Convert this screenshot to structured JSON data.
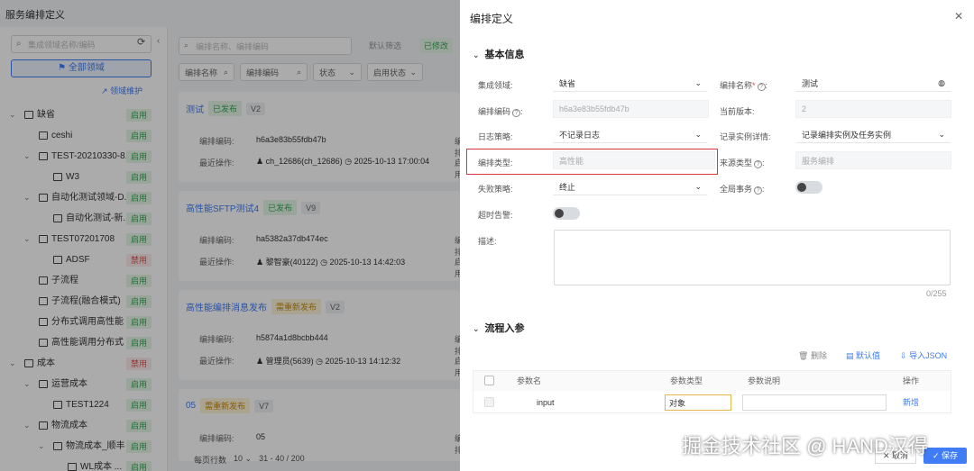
{
  "page_title": "服务编排定义",
  "left": {
    "search_placeholder": "集成领域名称/编码",
    "all_domains": "全部领域",
    "domain_maintenance": "领域维护",
    "tree": [
      {
        "label": "缺省",
        "badge": "启用",
        "status": "on",
        "level": 0,
        "toggle": "⌄",
        "icon": "folder-icon"
      },
      {
        "label": "ceshi",
        "badge": "启用",
        "status": "on",
        "level": 1,
        "toggle": "",
        "icon": "folder-icon"
      },
      {
        "label": "TEST-20210330-8...",
        "badge": "启用",
        "status": "on",
        "level": 1,
        "toggle": "⌄",
        "icon": "folder-icon"
      },
      {
        "label": "W3",
        "badge": "启用",
        "status": "on",
        "level": 2,
        "toggle": "",
        "icon": "node-icon"
      },
      {
        "label": "自动化测试领域-D...",
        "badge": "启用",
        "status": "on",
        "level": 1,
        "toggle": "⌄",
        "icon": "folder-icon"
      },
      {
        "label": "自动化测试-新...",
        "badge": "启用",
        "status": "on",
        "level": 2,
        "toggle": "",
        "icon": "folder-icon"
      },
      {
        "label": "TEST07201708",
        "badge": "启用",
        "status": "on",
        "level": 1,
        "toggle": "⌄",
        "icon": "folder-icon"
      },
      {
        "label": "ADSF",
        "badge": "禁用",
        "status": "off",
        "level": 2,
        "toggle": "",
        "icon": "folder-icon"
      },
      {
        "label": "子流程",
        "badge": "启用",
        "status": "on",
        "level": 1,
        "toggle": "",
        "icon": "subflow-icon"
      },
      {
        "label": "子流程(融合模式)",
        "badge": "启用",
        "status": "on",
        "level": 1,
        "toggle": "",
        "icon": "subflow-icon"
      },
      {
        "label": "分布式调用高性能",
        "badge": "启用",
        "status": "on",
        "level": 1,
        "toggle": "",
        "icon": "distributed-icon"
      },
      {
        "label": "高性能调用分布式",
        "badge": "启用",
        "status": "on",
        "level": 1,
        "toggle": "",
        "icon": "subflow-icon"
      },
      {
        "label": "成本",
        "badge": "禁用",
        "status": "off",
        "level": 0,
        "toggle": "⌄",
        "icon": "folder-icon"
      },
      {
        "label": "运营成本",
        "badge": "启用",
        "status": "on",
        "level": 1,
        "toggle": "⌄",
        "icon": "folder-icon"
      },
      {
        "label": "TEST1224",
        "badge": "启用",
        "status": "on",
        "level": 2,
        "toggle": "",
        "icon": "folder-icon"
      },
      {
        "label": "物流成本",
        "badge": "启用",
        "status": "on",
        "level": 1,
        "toggle": "⌄",
        "icon": "hierarchy-icon"
      },
      {
        "label": "物流成本_顺丰",
        "badge": "启用",
        "status": "on",
        "level": 2,
        "toggle": "⌄",
        "icon": "folder-icon"
      },
      {
        "label": "WL成本 ...",
        "badge": "启用",
        "status": "on",
        "level": 3,
        "toggle": "",
        "icon": "folder-icon"
      }
    ]
  },
  "mid": {
    "search_placeholder": "编排名称、编排编码",
    "default_filter": "默认筛选",
    "filter_tag": "已修改",
    "filters": [
      "编排名称",
      "编排编码",
      "状态",
      "启用状态"
    ],
    "cards": [
      {
        "name": "测试",
        "tag": "已发布",
        "tag_type": "pub",
        "version": "V2",
        "code_label": "编排编码:",
        "code": "h6a3e83b55fdb47b",
        "op_label": "最近操作:",
        "op_user": "ch_12686(ch_12686)",
        "op_time": "2025-10-13 17:00:04",
        "right_1": "编排",
        "right_2": "启用"
      },
      {
        "name": "高性能SFTP测试4",
        "tag": "已发布",
        "tag_type": "pub",
        "version": "V9",
        "code_label": "编排编码:",
        "code": "ha5382a37db474ec",
        "op_label": "最近操作:",
        "op_user": "黎智豪(40122)",
        "op_time": "2025-10-13 14:42:03",
        "right_1": "编排",
        "right_2": "启用"
      },
      {
        "name": "高性能编排消息发布",
        "tag": "需重新发布",
        "tag_type": "need",
        "version": "V2",
        "code_label": "编排编码:",
        "code": "h5874a1d8bcbb444",
        "op_label": "最近操作:",
        "op_user": "管理员(5639)",
        "op_time": "2025-10-13 14:12:32",
        "right_1": "编排",
        "right_2": "启用"
      },
      {
        "name": "05",
        "tag": "需重新发布",
        "tag_type": "need",
        "version": "V7",
        "code_label": "编排编码:",
        "code": "05",
        "op_label": "",
        "op_user": "",
        "op_time": "",
        "right_1": "编排",
        "right_2": ""
      }
    ],
    "pager_label": "每页行数",
    "pager_size": "10",
    "pager_range": "31 - 40 / 200"
  },
  "drawer": {
    "title": "编排定义",
    "basic_info": "基本信息",
    "fields": {
      "domain_label": "集成领域:",
      "domain_value": "缺省",
      "name_label": "编排名称",
      "name_value": "测试",
      "code_label": "编排编码",
      "code_value": "h6a3e83b55fdb47b",
      "version_label": "当前版本:",
      "version_value": "2",
      "log_label": "日志策略:",
      "log_value": "不记录日志",
      "record_label": "记录实例详情:",
      "record_value": "记录编排实例及任务实例",
      "type_label": "编排类型:",
      "type_value": "高性能",
      "source_label": "来源类型",
      "source_value": "服务编排",
      "fail_label": "失败策略:",
      "fail_value": "终止",
      "global_tx_label": "全局事务",
      "timeout_label": "超时告警:",
      "desc_label": "描述:",
      "desc_counter": "0/255"
    },
    "params_title": "流程入参",
    "tools": {
      "delete": "删除",
      "default": "默认值",
      "import_json": "导入JSON"
    },
    "table": {
      "headers": [
        "参数名",
        "参数类型",
        "参数说明",
        "操作"
      ],
      "rows": [
        {
          "name": "input",
          "type": "对象",
          "desc": "",
          "action": "新增"
        }
      ]
    },
    "cancel": "取消",
    "save": "保存"
  },
  "watermark": "掘金技术社区 @ HAND汉得"
}
